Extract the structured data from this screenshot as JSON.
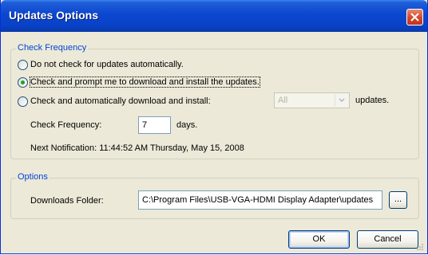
{
  "window": {
    "title": "Updates Options"
  },
  "check_frequency_group": {
    "legend": "Check Frequency",
    "options": [
      {
        "label": "Do not check for updates automatically.",
        "checked": false
      },
      {
        "label": "Check and prompt me to download and install the updates.",
        "checked": true
      },
      {
        "label": "Check and automatically download and install:",
        "checked": false
      }
    ],
    "auto_install_select": {
      "value": "All",
      "disabled": true
    },
    "auto_install_suffix": "updates.",
    "frequency_label": "Check Frequency:",
    "frequency_value": "7",
    "frequency_unit": "days.",
    "next_notification": "Next Notification: 11:44:52 AM Thursday, May 15, 2008"
  },
  "options_group": {
    "legend": "Options",
    "downloads_folder_label": "Downloads Folder:",
    "downloads_folder_value": "C:\\Program Files\\USB-VGA-HDMI Display Adapter\\updates",
    "browse_label": "..."
  },
  "buttons": {
    "ok": "OK",
    "cancel": "Cancel"
  },
  "colors": {
    "title_bar": "#0842c8",
    "group_legend": "#0046d5",
    "radio_checked": "#21a121",
    "close_button": "#d4462b"
  }
}
